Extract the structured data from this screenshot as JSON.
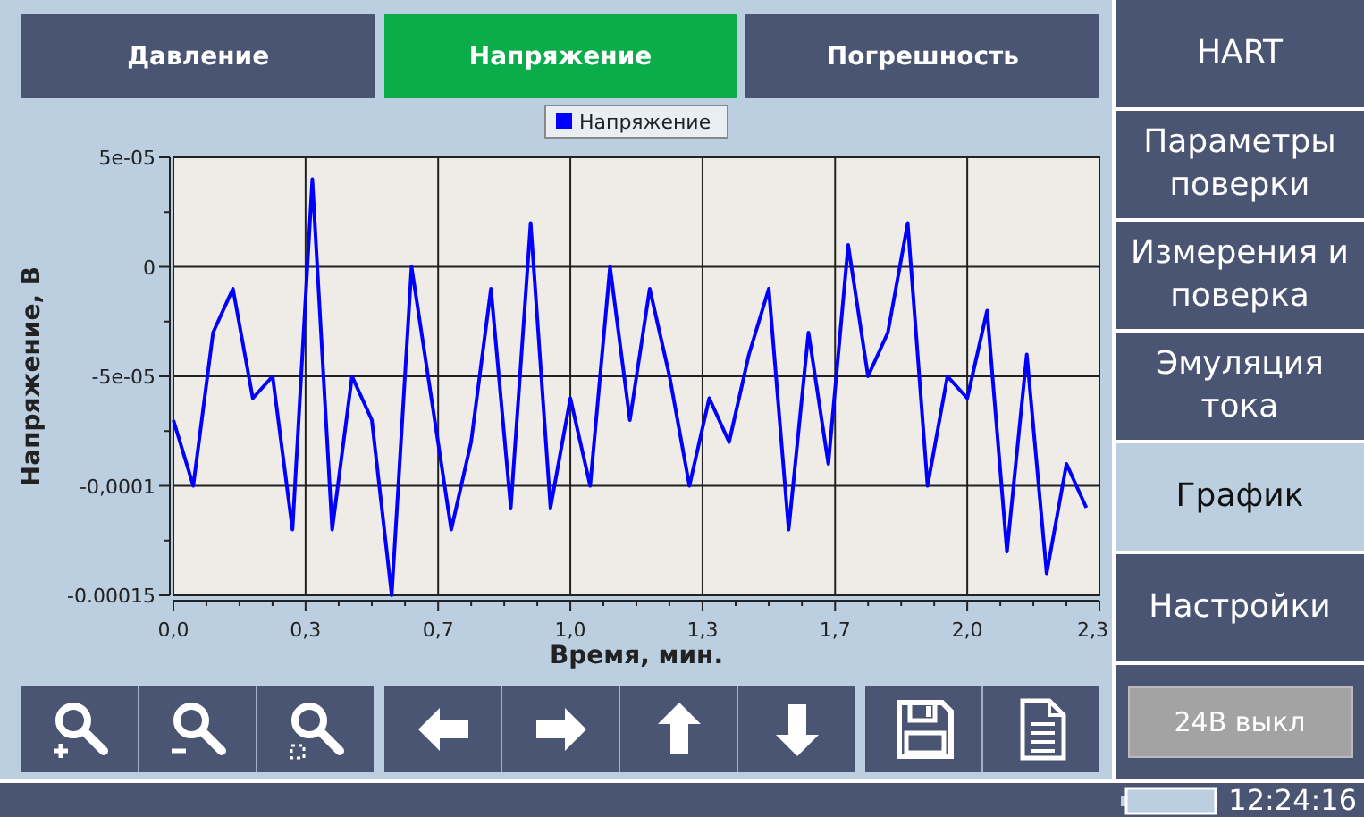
{
  "tabs": [
    {
      "label": "Давление",
      "selected": false
    },
    {
      "label": "Напряжение",
      "selected": true
    },
    {
      "label": "Погрешность",
      "selected": false
    }
  ],
  "chart": {
    "chart_data": {
      "type": "line",
      "grid": true,
      "xlabel": "Время, мин.",
      "ylabel": "Напряжение, В",
      "xlim": [
        0,
        2.333
      ],
      "ylim": [
        -0.00015,
        5e-05
      ],
      "xticks": [
        {
          "value": 0,
          "label": "0,0"
        },
        {
          "value": 0.333,
          "label": "0,3"
        },
        {
          "value": 0.667,
          "label": "0,7"
        },
        {
          "value": 1,
          "label": "1,0"
        },
        {
          "value": 1.333,
          "label": "1,3"
        },
        {
          "value": 1.667,
          "label": "1,7"
        },
        {
          "value": 2,
          "label": "2,0"
        },
        {
          "value": 2.333,
          "label": "2,3"
        }
      ],
      "yticks": [
        {
          "value": 5e-05,
          "label": "5e-05"
        },
        {
          "value": 0,
          "label": "0"
        },
        {
          "value": -5e-05,
          "label": "-5e-05"
        },
        {
          "value": -0.0001,
          "label": "-0,0001"
        },
        {
          "value": -0.00015,
          "label": "-0.00015"
        }
      ],
      "x": [
        0,
        0.05,
        0.1,
        0.15,
        0.2,
        0.25,
        0.3,
        0.35,
        0.4,
        0.45,
        0.5,
        0.55,
        0.6,
        0.65,
        0.7,
        0.75,
        0.8,
        0.85,
        0.9,
        0.95,
        1.0,
        1.05,
        1.1,
        1.15,
        1.2,
        1.25,
        1.3,
        1.35,
        1.4,
        1.45,
        1.5,
        1.55,
        1.6,
        1.65,
        1.7,
        1.75,
        1.8,
        1.85,
        1.9,
        1.95,
        2.0,
        2.05,
        2.1,
        2.15,
        2.2,
        2.25,
        2.3
      ],
      "series": [
        {
          "name": "Напряжение",
          "color": "#0000ff",
          "values": [
            -7e-05,
            -0.0001,
            -3e-05,
            -1e-05,
            -6e-05,
            -5e-05,
            -0.00012,
            4e-05,
            -0.00012,
            -5e-05,
            -7e-05,
            -0.00015,
            0,
            -6e-05,
            -0.00012,
            -8e-05,
            -1e-05,
            -0.00011,
            2e-05,
            -0.00011,
            -6e-05,
            -0.0001,
            0,
            -7e-05,
            -1e-05,
            -5e-05,
            -0.0001,
            -6e-05,
            -8e-05,
            -4e-05,
            -1e-05,
            -0.00012,
            -3e-05,
            -9e-05,
            1e-05,
            -5e-05,
            -3e-05,
            2e-05,
            -0.0001,
            -5e-05,
            -6e-05,
            -2e-05,
            -0.00013,
            -4e-05,
            -0.00014,
            -9e-05,
            -0.00011
          ]
        }
      ]
    }
  },
  "toolbar": [
    [
      {
        "kind": "zoom-in"
      },
      {
        "kind": "zoom-out"
      },
      {
        "kind": "zoom-area"
      }
    ],
    [
      {
        "kind": "left"
      },
      {
        "kind": "right"
      },
      {
        "kind": "up"
      },
      {
        "kind": "down"
      }
    ],
    [
      {
        "kind": "save"
      },
      {
        "kind": "document"
      }
    ]
  ],
  "sidebar": {
    "items": [
      {
        "label": "HART",
        "selected": false
      },
      {
        "label": "Параметры поверки",
        "selected": false
      },
      {
        "label": "Измерения и поверка",
        "selected": false
      },
      {
        "label": "Эмуляция тока",
        "selected": false
      },
      {
        "label": "График",
        "selected": true
      },
      {
        "label": "Настройки",
        "selected": false
      }
    ],
    "power_button": {
      "label": "24В выкл"
    }
  },
  "status_bar": {
    "time": "12:24:16"
  }
}
